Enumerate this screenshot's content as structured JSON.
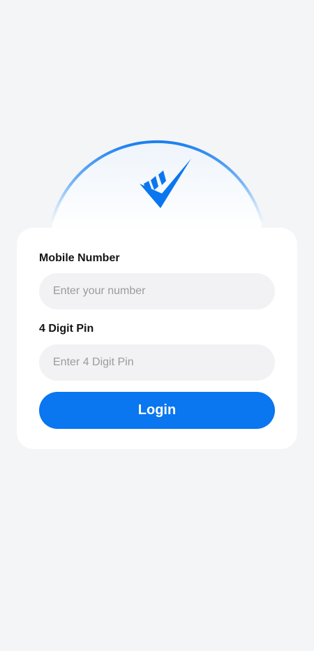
{
  "colors": {
    "background": "#f4f5f7",
    "card": "#ffffff",
    "accent": "#0a76f0",
    "input_fill": "#f2f2f4",
    "placeholder": "#9a9aa0"
  },
  "logo": {
    "icon": "checkmark-logo-icon"
  },
  "form": {
    "mobile_label": "Mobile Number",
    "mobile_placeholder": "Enter your number",
    "mobile_value": "",
    "pin_label": "4 Digit Pin",
    "pin_placeholder": "Enter 4 Digit Pin",
    "pin_value": "",
    "login_label": "Login"
  }
}
